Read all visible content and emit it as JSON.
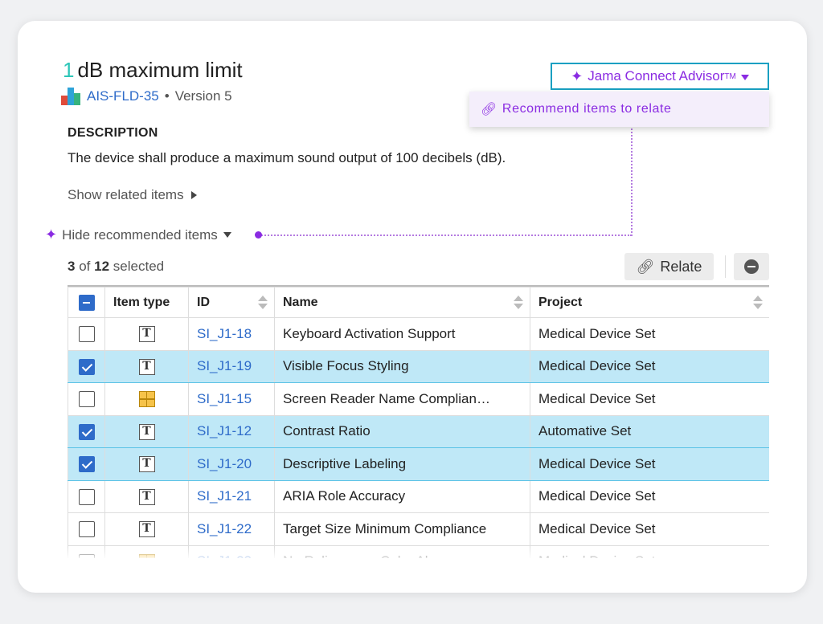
{
  "item": {
    "title_num": "1",
    "title_text": "dB maximum limit",
    "id": "AIS-FLD-35",
    "separator": "•",
    "version": "Version 5",
    "description_label": "DESCRIPTION",
    "description": "The device shall produce a maximum sound output of 100 decibels (dB).",
    "show_related": "Show related items",
    "hide_recommended": "Hide recommended items"
  },
  "advisor": {
    "label": "Jama Connect Advisor",
    "trademark": "TM",
    "menu_item": "Recommend items to relate"
  },
  "selection": {
    "selected": "3",
    "of": "of",
    "total": "12",
    "suffix": "selected"
  },
  "toolbar": {
    "relate_label": "Relate"
  },
  "colors": {
    "accent_purple": "#8a2be2",
    "accent_teal": "#2cc6b8",
    "link_blue": "#2e6bc9",
    "selected_row": "#bfe8f7"
  },
  "table": {
    "headers": [
      "Item type",
      "ID",
      "Name",
      "Project"
    ],
    "rows": [
      {
        "checked": false,
        "type": "text-icon",
        "id": "SI_J1-18",
        "name": "Keyboard Activation Support",
        "project": "Medical Device Set"
      },
      {
        "checked": true,
        "type": "text-icon",
        "id": "SI_J1-19",
        "name": "Visible Focus Styling",
        "project": "Medical Device Set"
      },
      {
        "checked": false,
        "type": "grid-icon",
        "id": "SI_J1-15",
        "name": "Screen Reader Name Complian…",
        "project": "Medical Device Set"
      },
      {
        "checked": true,
        "type": "text-icon",
        "id": "SI_J1-12",
        "name": "Contrast Ratio",
        "project": "Automative Set"
      },
      {
        "checked": true,
        "type": "text-icon",
        "id": "SI_J1-20",
        "name": "Descriptive Labeling",
        "project": "Medical Device Set"
      },
      {
        "checked": false,
        "type": "text-icon",
        "id": "SI_J1-21",
        "name": "ARIA Role Accuracy",
        "project": "Medical Device Set"
      },
      {
        "checked": false,
        "type": "text-icon",
        "id": "SI_J1-22",
        "name": "Target Size Minimum Compliance",
        "project": "Medical Device Set"
      },
      {
        "checked": false,
        "type": "grid-icon",
        "id": "SI_J1-23",
        "name": "No Reliance on Color Alone",
        "project": "Medical Device Set"
      }
    ]
  }
}
